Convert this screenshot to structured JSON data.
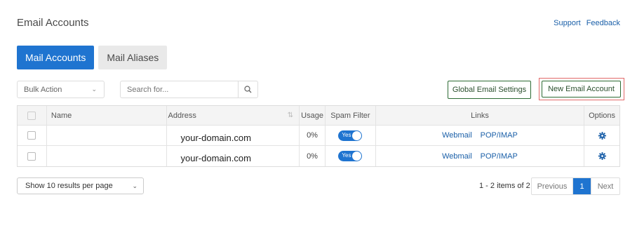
{
  "header": {
    "title": "Email Accounts",
    "support_link": "Support",
    "feedback_link": "Feedback"
  },
  "tabs": [
    {
      "label": "Mail Accounts",
      "active": true
    },
    {
      "label": "Mail Aliases",
      "active": false
    }
  ],
  "toolbar": {
    "bulk_action": "Bulk Action",
    "search_placeholder": "Search for...",
    "global_settings_label": "Global Email Settings",
    "new_account_label": "New Email Account"
  },
  "table": {
    "columns": {
      "name": "Name",
      "address": "Address",
      "usage": "Usage",
      "spam": "Spam Filter",
      "links": "Links",
      "options": "Options"
    },
    "rows": [
      {
        "name": "",
        "address": "your-domain.com",
        "usage": "0%",
        "spam": "Yes",
        "link_webmail": "Webmail",
        "link_pop": "POP/IMAP"
      },
      {
        "name": "",
        "address": "your-domain.com",
        "usage": "0%",
        "spam": "Yes",
        "link_webmail": "Webmail",
        "link_pop": "POP/IMAP"
      }
    ]
  },
  "footer": {
    "per_page": "Show 10 results per page",
    "items_info": "1 - 2 items of 2",
    "previous": "Previous",
    "current_page": "1",
    "next": "Next"
  },
  "colors": {
    "accent": "#1f74d0",
    "link": "#1a5fa8",
    "outline_button": "#2d6b34",
    "highlight_border": "#e26a6a"
  },
  "icons": {
    "search": "search-icon",
    "gear": "gear-icon",
    "sort": "sort-icon",
    "chevron": "chevron-down-icon"
  }
}
